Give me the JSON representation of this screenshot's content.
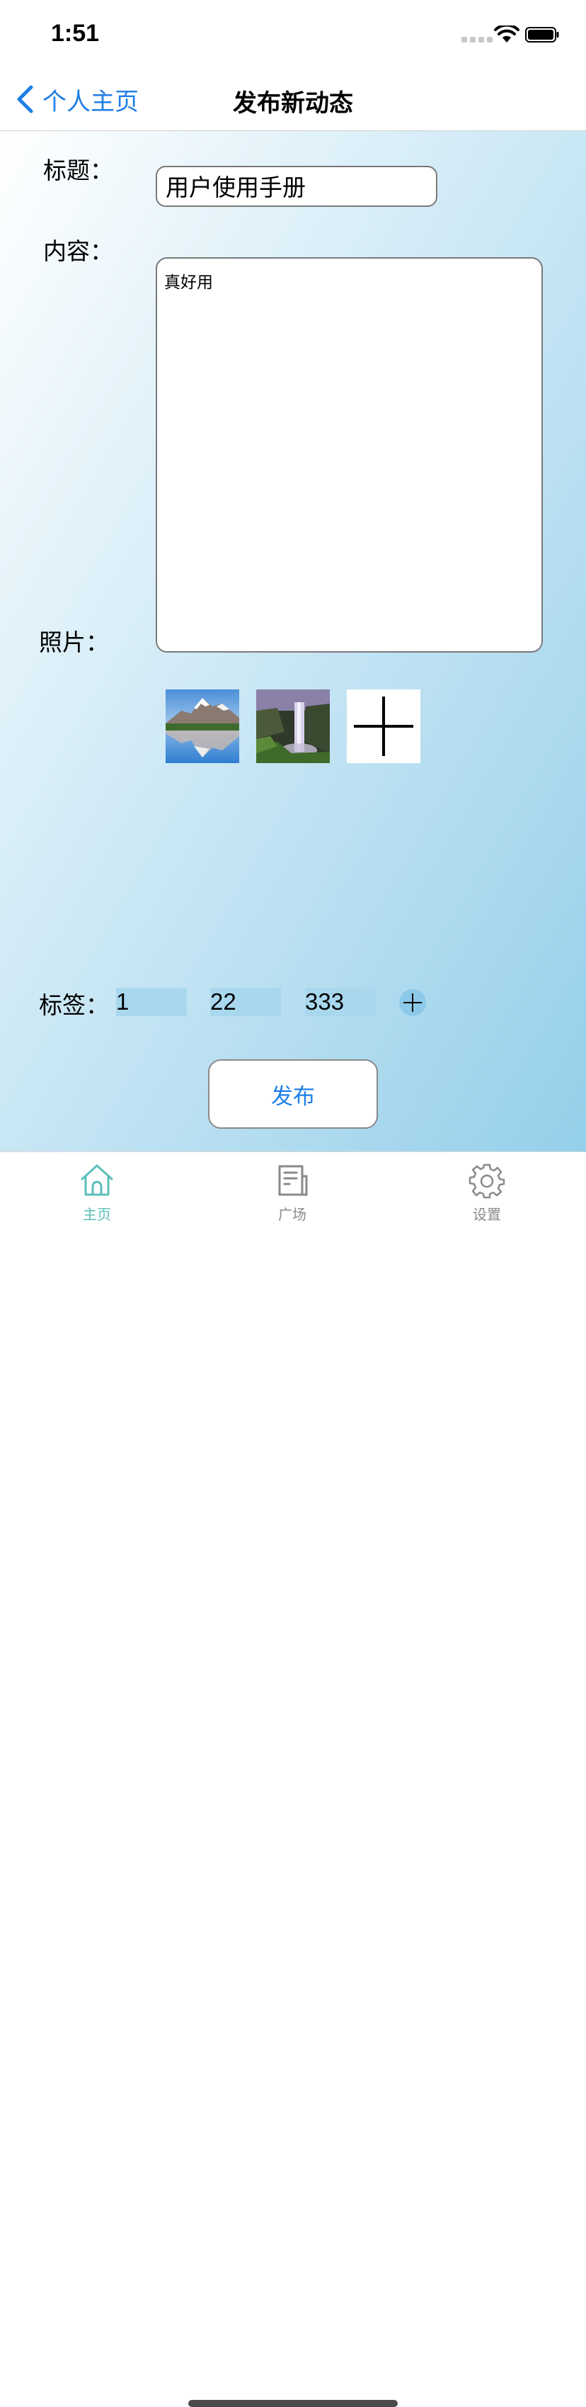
{
  "status_bar": {
    "time": "1:51"
  },
  "nav": {
    "back_label": "个人主页",
    "title": "发布新动态"
  },
  "form": {
    "title_label": "标题：",
    "title_value": "用户使用手册",
    "content_label": "内容：",
    "content_value": "真好用",
    "photos_label": "照片：",
    "photos": [
      "mountain-lake-photo",
      "waterfall-photo"
    ],
    "tags_label": "标签：",
    "tags": [
      "1",
      "22",
      "333"
    ],
    "publish_label": "发布"
  },
  "tabbar": {
    "items": [
      {
        "label": "主页",
        "icon": "home-icon",
        "active": true
      },
      {
        "label": "广场",
        "icon": "news-icon",
        "active": false
      },
      {
        "label": "设置",
        "icon": "gear-icon",
        "active": false
      }
    ]
  },
  "colors": {
    "accent": "#1f7fe6",
    "tab_active": "#5bbfb8",
    "tab_inactive": "#8a8a8a"
  }
}
